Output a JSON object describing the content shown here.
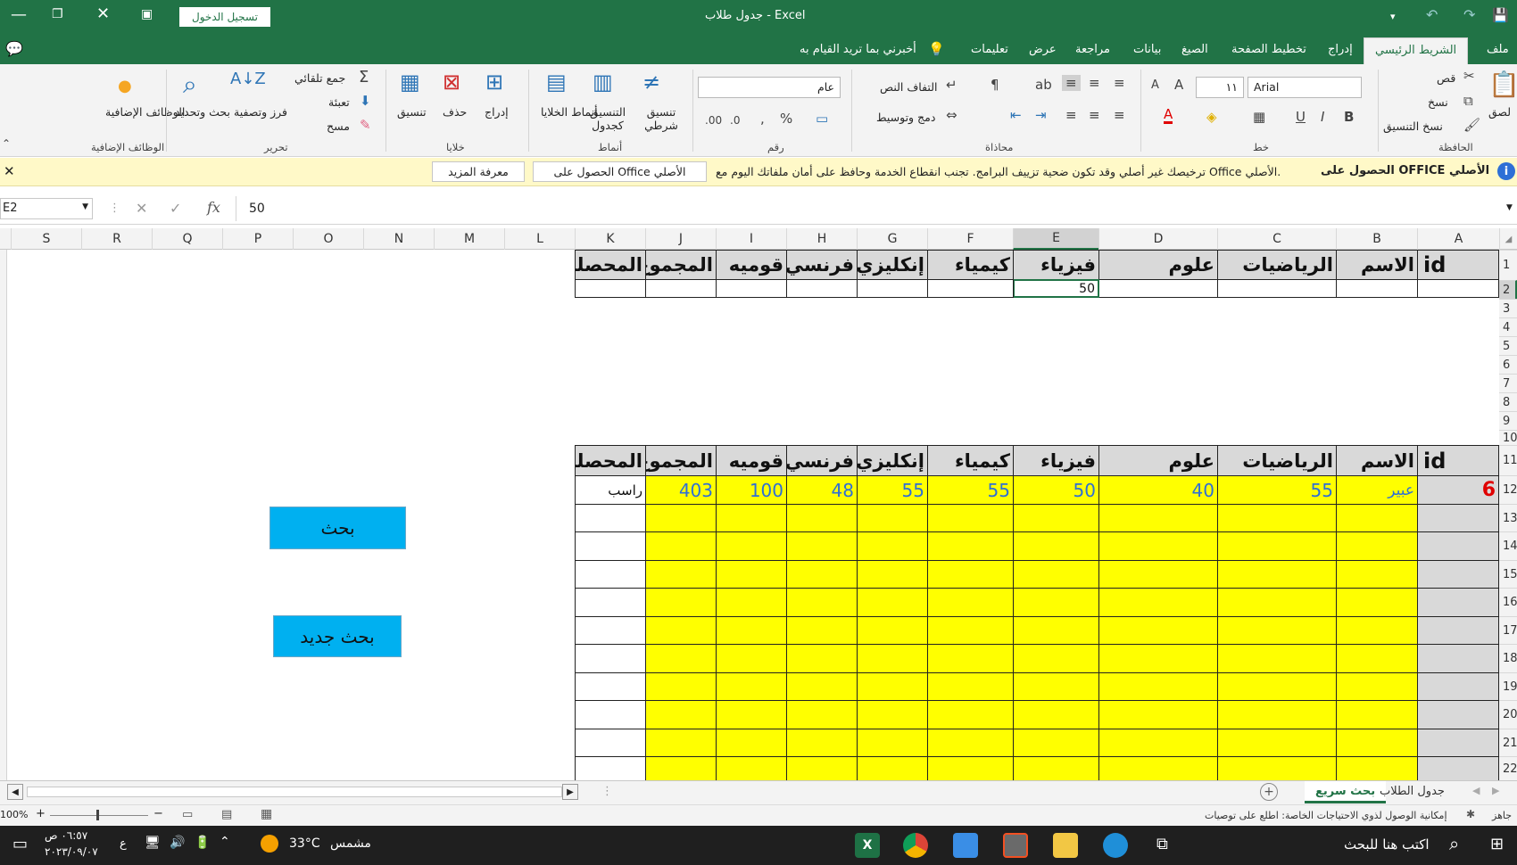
{
  "title_bar": {
    "title": "جدول طلاب  -  Excel",
    "sign_in": "تسجيل الدخول"
  },
  "tabs": [
    "ملف",
    "الشريط الرئيسي",
    "إدراج",
    "تخطيط الصفحة",
    "الصيغ",
    "بيانات",
    "مراجعة",
    "عرض",
    "تعليمات",
    "أخبرني بما تريد القيام به"
  ],
  "ribbon": {
    "clipboard": {
      "paste": "لصق",
      "cut": "قص",
      "copy": "نسخ",
      "format_painter": "نسخ التنسيق",
      "label": "الحافظة"
    },
    "font": {
      "name": "Arial",
      "size": "١١",
      "bold": "B",
      "italic": "I",
      "underline": "U",
      "label": "خط"
    },
    "alignment": {
      "wrap": "التفاف النص",
      "merge": "دمج وتوسيط",
      "label": "محاذاة"
    },
    "number": {
      "format": "عام",
      "label": "رقم"
    },
    "styles": {
      "conditional": "تنسيق شرطي",
      "as_table": "التنسيق كجدول",
      "cell_styles": "أنماط الخلايا",
      "label": "أنماط"
    },
    "cells": {
      "insert": "إدراج",
      "delete": "حذف",
      "format": "تنسيق",
      "label": "خلايا"
    },
    "editing": {
      "autosum": "جمع تلقائي",
      "fill": "تعبئة",
      "clear": "مسح",
      "sort": "فرز وتصفية",
      "find": "بحث وتحديد",
      "label": "تحرير"
    },
    "addins": {
      "button": "الوظائف الإضافية",
      "label": "الوظائف الإضافية"
    }
  },
  "message_bar": {
    "title": "الحصول على OFFICE الأصلي",
    "text": "ترخيصك غير أصلي وقد تكون ضحية تزييف البرامج. تجنب انقطاع الخدمة وحافظ على أمان ملفاتك اليوم مع Office الأصلي.",
    "get_button": "الحصول على Office الأصلي",
    "learn_button": "معرفة المزيد"
  },
  "formula_bar": {
    "name_box": "E2",
    "fx": "fx",
    "value": "50"
  },
  "columns": [
    "A",
    "B",
    "C",
    "D",
    "E",
    "F",
    "G",
    "H",
    "I",
    "J",
    "K",
    "L",
    "M",
    "N",
    "O",
    "P",
    "Q",
    "R",
    "S"
  ],
  "rows": [
    "1",
    "2",
    "3",
    "4",
    "5",
    "6",
    "7",
    "8",
    "9",
    "10",
    "11",
    "12",
    "13",
    "14",
    "15",
    "16",
    "17",
    "18",
    "19",
    "20",
    "21",
    "22"
  ],
  "sheet": {
    "header_row": [
      "id",
      "الاسم",
      "الرياضيات",
      "علوم",
      "فيزياء",
      "كيمياء",
      "إنكليزي",
      "فرنسي",
      "قوميه",
      "المجموع",
      "المحصله"
    ],
    "row2_E": "50",
    "result_row": [
      "6",
      "عبير",
      "55",
      "40",
      "50",
      "55",
      "55",
      "48",
      "100",
      "403",
      "راسب"
    ]
  },
  "buttons": {
    "search": "بحث",
    "new_search": "بحث جديد"
  },
  "sheet_tabs": [
    "جدول الطلاب",
    "بحث سريع"
  ],
  "status": {
    "ready": "جاهز",
    "accessibility": "إمكانية الوصول لذوي الاحتياجات الخاصة: اطلع على توصيات",
    "zoom": "100%"
  },
  "taskbar": {
    "search": "اكتب هنا للبحث",
    "weather": "مشمس",
    "temp": "33°C",
    "time": "٠٦:٥٧ ص",
    "date": "٢٠٢٣/٠٩/٠٧",
    "lang": "ع"
  },
  "colors": {
    "excel_green": "#217346",
    "header_gray": "#d9d9d9",
    "highlight_yellow": "#ffff00",
    "button_blue": "#00b0f0",
    "id_red": "#e00000",
    "value_blue": "#2e6fd6"
  }
}
